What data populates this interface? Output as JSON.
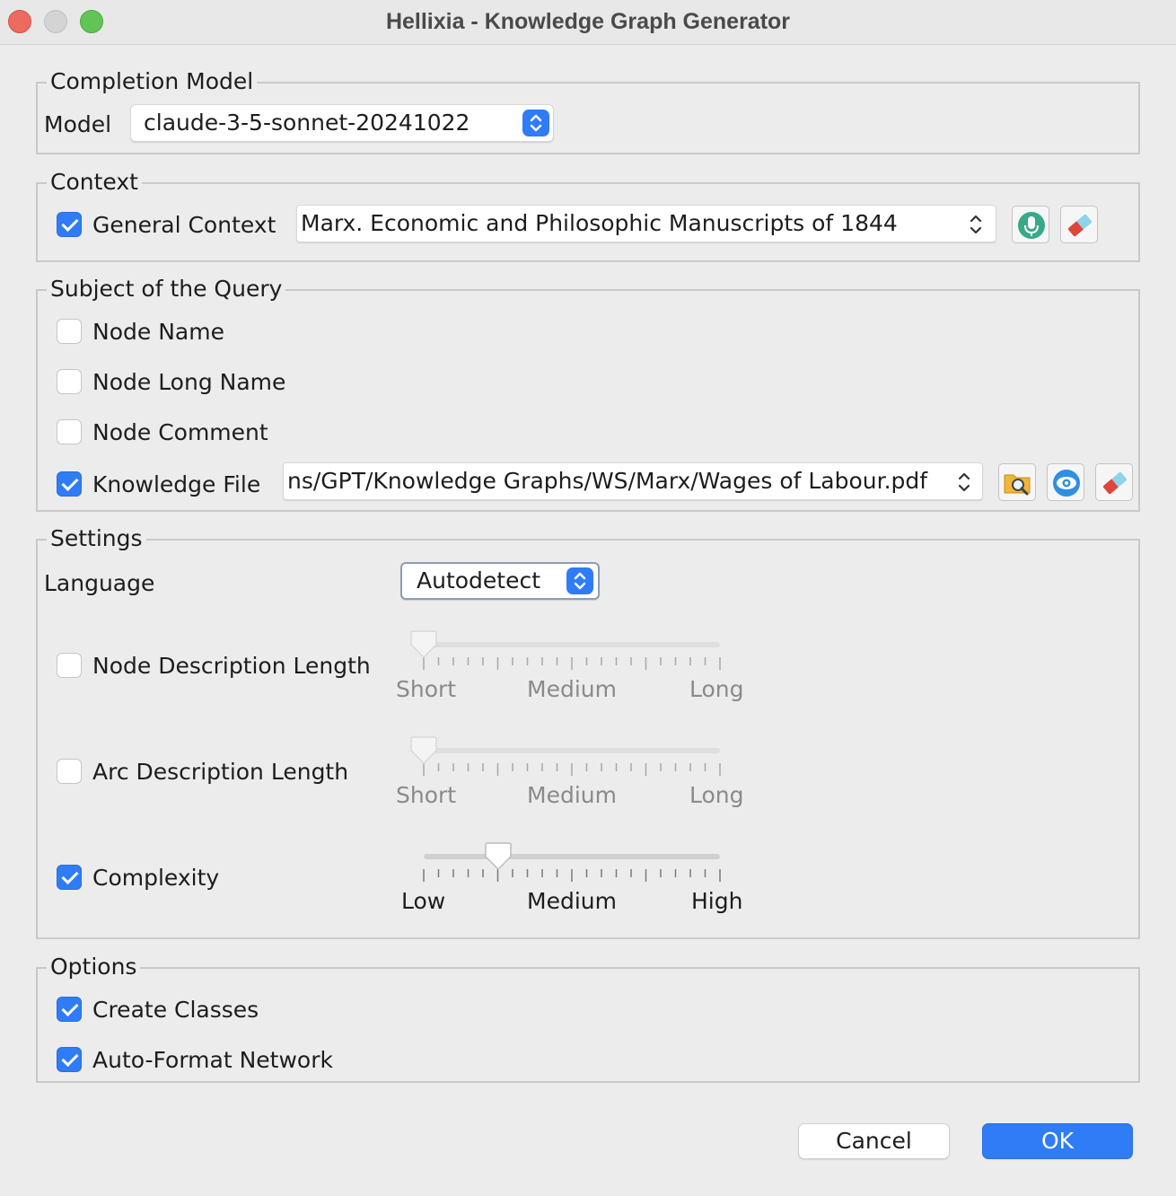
{
  "window": {
    "title": "Hellixia - Knowledge Graph Generator"
  },
  "completion_model": {
    "legend": "Completion Model",
    "model_label": "Model",
    "model_value": "claude-3-5-sonnet-20241022"
  },
  "context": {
    "legend": "Context",
    "general_context_label": "General Context",
    "general_context_checked": true,
    "general_context_value": "Marx. Economic and Philosophic Manuscripts of 1844",
    "icons": [
      "microphone-icon",
      "eraser-icon"
    ]
  },
  "subject": {
    "legend": "Subject of the Query",
    "items": [
      {
        "label": "Node Name",
        "checked": false
      },
      {
        "label": "Node Long Name",
        "checked": false
      },
      {
        "label": "Node Comment",
        "checked": false
      },
      {
        "label": "Knowledge File",
        "checked": true
      }
    ],
    "knowledge_file_value": "ns/GPT/Knowledge Graphs/WS/Marx/Wages of Labour.pdf",
    "icons": [
      "folder-search-icon",
      "eye-icon",
      "eraser-icon"
    ]
  },
  "settings": {
    "legend": "Settings",
    "language_label": "Language",
    "language_value": "Autodetect",
    "node_description": {
      "label": "Node Description Length",
      "checked": false,
      "ticks": [
        "Short",
        "Medium",
        "Long"
      ],
      "value": 0
    },
    "arc_description": {
      "label": "Arc Description Length",
      "checked": false,
      "ticks": [
        "Short",
        "Medium",
        "Long"
      ],
      "value": 0
    },
    "complexity": {
      "label": "Complexity",
      "checked": true,
      "ticks": [
        "Low",
        "Medium",
        "High"
      ],
      "value": 0.25
    }
  },
  "options": {
    "legend": "Options",
    "create_classes_label": "Create Classes",
    "create_classes_checked": true,
    "auto_format_label": "Auto-Format Network",
    "auto_format_checked": true
  },
  "buttons": {
    "cancel": "Cancel",
    "ok": "OK"
  },
  "colors": {
    "accent": "#2f7cf6"
  }
}
